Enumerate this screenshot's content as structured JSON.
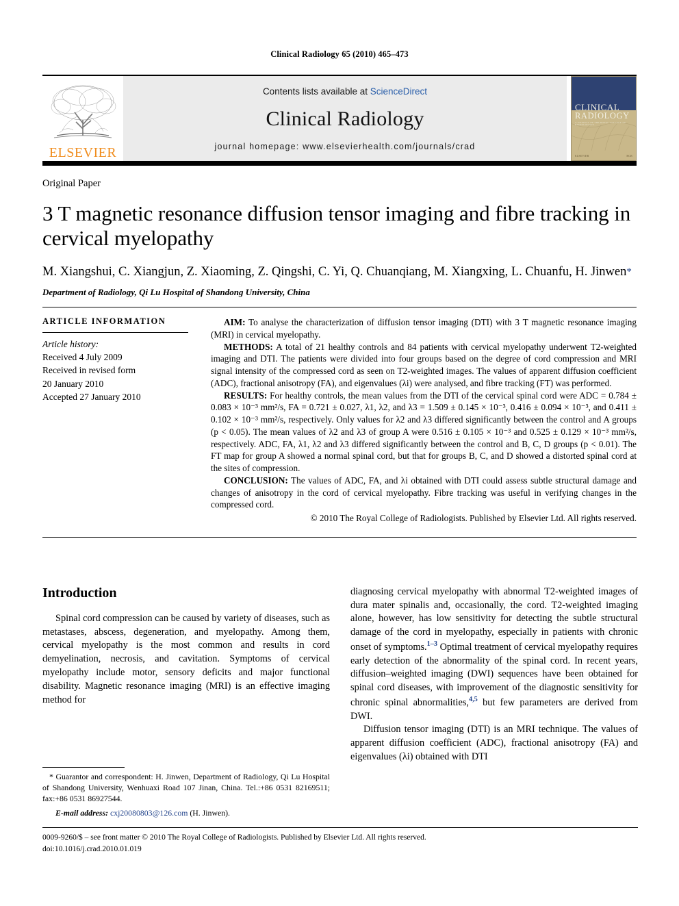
{
  "running_head": "Clinical Radiology 65 (2010) 465–473",
  "masthead": {
    "publisher_name": "ELSEVIER",
    "contents_prefix": "Contents lists available at ",
    "contents_link": "ScienceDirect",
    "journal_name": "Clinical Radiology",
    "homepage": "journal homepage: www.elsevierhealth.com/journals/crad",
    "cover": {
      "line1": "CLINICAL",
      "line2": "RADIOLOGY",
      "subtitle": "A JOURNAL OF THE ROYAL COLLEGE OF RADIOLOGISTS",
      "foot_left": "ELSEVIER",
      "foot_right": "RCR"
    },
    "colors": {
      "banner_bg": "#ebebeb",
      "link": "#2b5faa",
      "elsevier_orange": "#F08C1C",
      "cover_navy": "#2e4272",
      "cover_tan": "#c9b88a"
    }
  },
  "article": {
    "type": "Original Paper",
    "title": "3 T magnetic resonance diffusion tensor imaging and fibre tracking in cervical myelopathy",
    "authors": "M. Xiangshui, C. Xiangjun, Z. Xiaoming, Z. Qingshi, C. Yi, Q. Chuanqiang, M. Xiangxing, L. Chuanfu, H. Jinwen",
    "corresponding_marker": "*",
    "affiliation": "Department of Radiology, Qi Lu Hospital of Shandong University, China"
  },
  "article_information": {
    "heading": "ARTICLE INFORMATION",
    "history_label": "Article history:",
    "history": [
      "Received 4 July 2009",
      "Received in revised form",
      "20 January 2010",
      "Accepted 27 January 2010"
    ]
  },
  "abstract": {
    "aim_label": "AIM:",
    "aim_text": " To analyse the characterization of diffusion tensor imaging (DTI) with 3 T magnetic resonance imaging (MRI) in cervical myelopathy.",
    "methods_label": "METHODS:",
    "methods_text": " A total of 21 healthy controls and 84 patients with cervical myelopathy underwent T2-weighted imaging and DTI. The patients were divided into four groups based on the degree of cord compression and MRI signal intensity of the compressed cord as seen on T2-weighted images. The values of apparent diffusion coefficient (ADC), fractional anisotropy (FA), and eigenvalues (λi) were analysed, and fibre tracking (FT) was performed.",
    "results_label": "RESULTS:",
    "results_text": " For healthy controls, the mean values from the DTI of the cervical spinal cord were ADC = 0.784 ± 0.083 × 10⁻³ mm²/s, FA = 0.721 ± 0.027, λ1, λ2, and λ3 = 1.509 ± 0.145 × 10⁻³, 0.416 ± 0.094 × 10⁻³, and 0.411 ± 0.102 × 10⁻³ mm²/s, respectively. Only values for λ2 and λ3 differed significantly between the control and A groups (p < 0.05). The mean values of λ2 and λ3 of group A were 0.516 ± 0.105 × 10⁻³ and 0.525 ± 0.129 × 10⁻³ mm²/s, respectively. ADC, FA, λ1, λ2 and λ3 differed significantly between the control and B, C, D groups (p < 0.01). The FT map for group A showed a normal spinal cord, but that for groups B, C, and D showed a distorted spinal cord at the sites of compression.",
    "conclusion_label": "CONCLUSION:",
    "conclusion_text": " The values of ADC, FA, and λi obtained with DTI could assess subtle structural damage and changes of anisotropy in the cord of cervical myelopathy. Fibre tracking was useful in verifying changes in the compressed cord.",
    "copyright": "© 2010 The Royal College of Radiologists. Published by Elsevier Ltd. All rights reserved."
  },
  "introduction": {
    "heading": "Introduction",
    "left_paragraph": "Spinal cord compression can be caused by variety of diseases, such as metastases, abscess, degeneration, and myelopathy. Among them, cervical myelopathy is the most common and results in cord demyelination, necrosis, and cavitation. Symptoms of cervical myelopathy include motor, sensory deficits and major functional disability. Magnetic resonance imaging (MRI) is an effective imaging method for",
    "right_paragraph_1a": "diagnosing cervical myelopathy with abnormal T2-weighted images of dura mater spinalis and, occasionally, the cord. T2-weighted imaging alone, however, has low sensitivity for detecting the subtle structural damage of the cord in myelopathy, especially in patients with chronic onset of symptoms.",
    "right_paragraph_1_ref": "1–3",
    "right_paragraph_1b": " Optimal treatment of cervical myelopathy requires early detection of the abnormality of the spinal cord. In recent years, diffusion–weighted imaging (DWI) sequences have been obtained for spinal cord diseases, with improvement of the diagnostic sensitivity for chronic spinal abnormalities,",
    "right_paragraph_1_ref2": "4,5",
    "right_paragraph_1c": " but few parameters are derived from DWI.",
    "right_paragraph_2": "Diffusion tensor imaging (DTI) is an MRI technique. The values of apparent diffusion coefficient (ADC), fractional anisotropy (FA) and eigenvalues (λi) obtained with DTI"
  },
  "footnote": {
    "marker": "*",
    "text": " Guarantor and correspondent: H. Jinwen, Department of Radiology, Qi Lu Hospital of Shandong University, Wenhuaxi Road 107 Jinan, China. Tel.:+86 0531 82169511; fax:+86 0531 86927544.",
    "email_label": "E-mail address:",
    "email_address": "cxj20080803@126.com",
    "email_suffix": " (H. Jinwen)."
  },
  "colophon": {
    "line1": "0009-9260/$ – see front matter © 2010 The Royal College of Radiologists. Published by Elsevier Ltd. All rights reserved.",
    "line2": "doi:10.1016/j.crad.2010.01.019"
  }
}
